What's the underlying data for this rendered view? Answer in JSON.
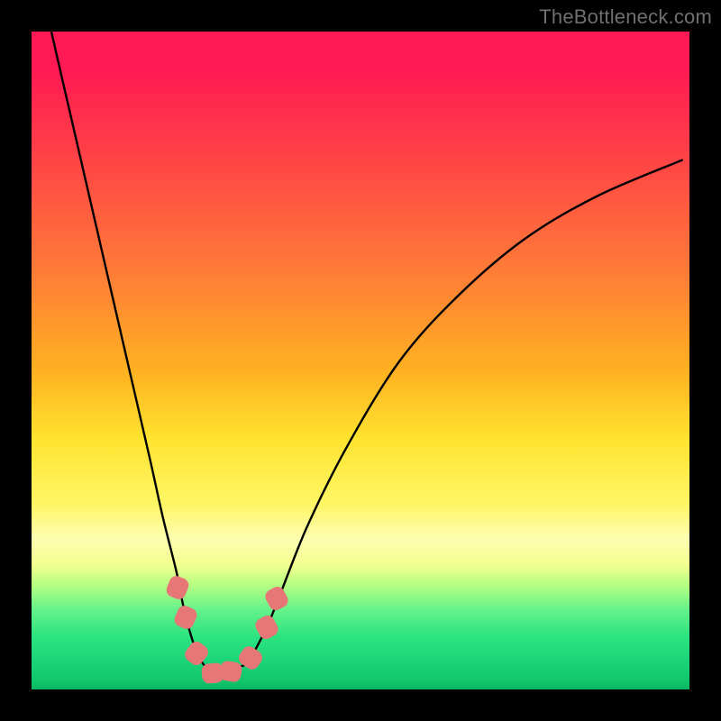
{
  "watermark": "TheBottleneck.com",
  "colors": {
    "frame_bg": "#000000",
    "watermark_text": "#6f6f6f",
    "curve_stroke": "#000000",
    "knot_fill": "#e77777",
    "gradient_stops": [
      "#ff1a53",
      "#ff3f47",
      "#ff7a38",
      "#ffb321",
      "#ffe430",
      "#fff667",
      "#fdfdb0",
      "#f4ff90",
      "#b7ff82",
      "#63f28a",
      "#2ce381",
      "#1ed87a",
      "#10c46b",
      "#08b561"
    ]
  },
  "chart_data": {
    "type": "line",
    "title": "",
    "xlabel": "",
    "ylabel": "",
    "xlim": [
      0,
      100
    ],
    "ylim": [
      0,
      100
    ],
    "grid": false,
    "series": [
      {
        "name": "bottleneck-curve",
        "x": [
          3,
          6,
          9,
          12,
          15,
          18,
          20,
          22,
          23,
          24,
          25,
          26,
          27,
          28,
          29,
          30,
          33,
          34,
          36,
          38,
          42,
          48,
          56,
          65,
          75,
          86,
          99
        ],
        "y": [
          100,
          87,
          74,
          61,
          48,
          35,
          26,
          18,
          13,
          9,
          6,
          4,
          3,
          2.5,
          2.5,
          3,
          4,
          6,
          10,
          15,
          25,
          37,
          50,
          60,
          68.5,
          75,
          80.5
        ]
      }
    ],
    "knots": [
      {
        "x": 22.2,
        "y": 15.5,
        "rot_deg": 22
      },
      {
        "x": 23.4,
        "y": 11.0,
        "rot_deg": 24
      },
      {
        "x": 25.0,
        "y": 5.5,
        "rot_deg": 38
      },
      {
        "x": 27.6,
        "y": 2.4,
        "rot_deg": 85
      },
      {
        "x": 30.3,
        "y": 2.8,
        "rot_deg": -80
      },
      {
        "x": 33.3,
        "y": 4.8,
        "rot_deg": -56
      },
      {
        "x": 35.7,
        "y": 9.5,
        "rot_deg": -30
      },
      {
        "x": 37.3,
        "y": 13.8,
        "rot_deg": -28
      }
    ]
  }
}
